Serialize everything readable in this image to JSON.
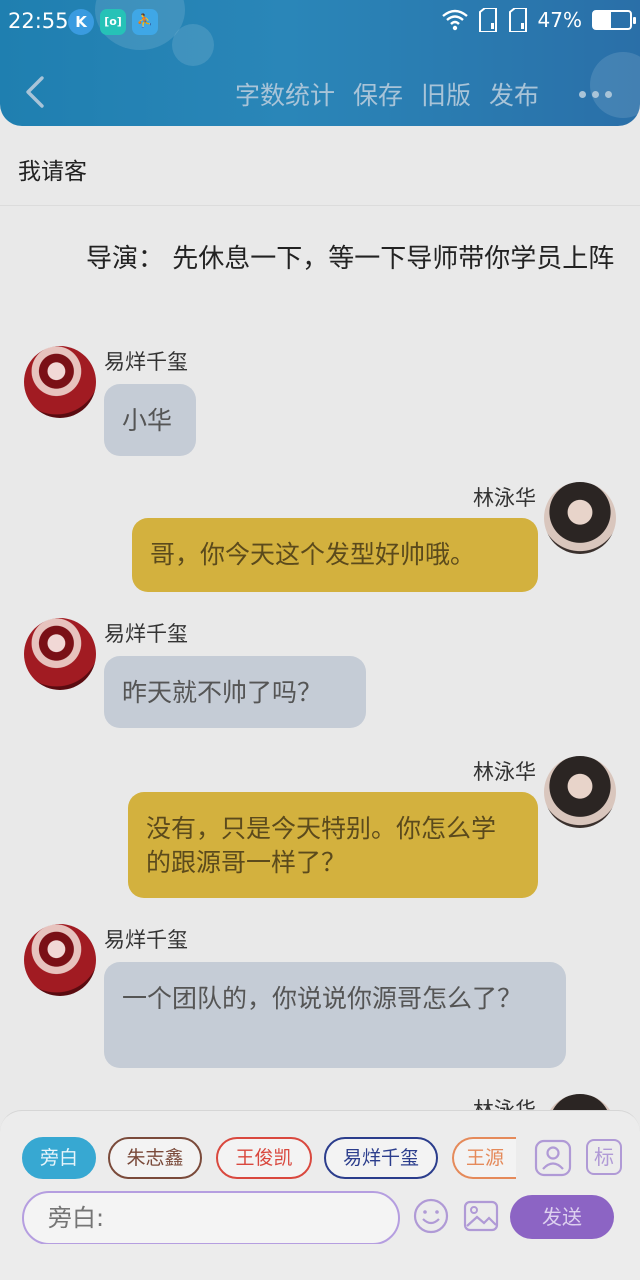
{
  "status_bar": {
    "time": "22:55",
    "apps": [
      "K",
      "[o]",
      "⛹"
    ],
    "battery_pct": "47%",
    "battery_level": 0.47
  },
  "header": {
    "actions": [
      "字数统计",
      "保存",
      "旧版",
      "发布"
    ]
  },
  "document": {
    "title": "我请客"
  },
  "narration": "导演： 先休息一下，等一下导师带你学员上阵",
  "messages": [
    {
      "side": "left",
      "sender": "易烊千玺",
      "text": "小华"
    },
    {
      "side": "right",
      "sender": "林泳华",
      "text": "哥，你今天这个发型好帅哦。"
    },
    {
      "side": "left",
      "sender": "易烊千玺",
      "text": "昨天就不帅了吗？"
    },
    {
      "side": "right",
      "sender": "林泳华",
      "text": "没有，只是今天特别。你怎么学的跟源哥一样了？"
    },
    {
      "side": "left",
      "sender": "易烊千玺",
      "text": "一个团队的，你说说你源哥怎么了？"
    },
    {
      "side": "right",
      "sender": "林泳华",
      "text": ""
    }
  ],
  "roles": [
    {
      "label": "旁白",
      "active": true,
      "color": "#37a8d2"
    },
    {
      "label": "朱志鑫",
      "active": false,
      "color": "#7a4a3a"
    },
    {
      "label": "王俊凯",
      "active": false,
      "color": "#d9483e"
    },
    {
      "label": "易烊千玺",
      "active": false,
      "color": "#2b3d8c"
    },
    {
      "label": "王源",
      "active": false,
      "color": "#e58a5a"
    }
  ],
  "side_buttons": {
    "mark_label": "标"
  },
  "composer": {
    "placeholder": "旁白:",
    "send_label": "发送"
  },
  "colors": {
    "header": "#2a86b8",
    "send": "#8c64c4",
    "accent_border": "#b59ee0"
  }
}
